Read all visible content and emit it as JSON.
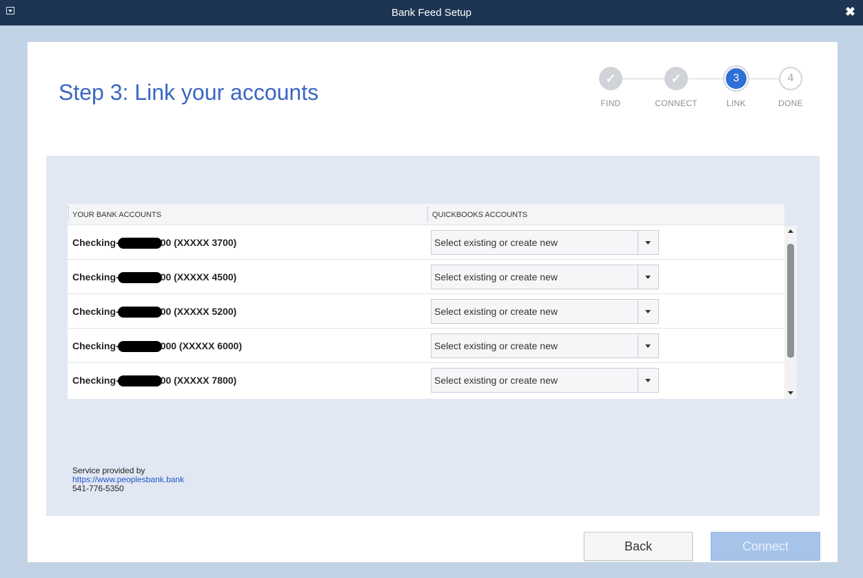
{
  "window": {
    "title": "Bank Feed Setup"
  },
  "page": {
    "heading": "Step 3: Link your accounts"
  },
  "steps": [
    {
      "label": "FIND",
      "state": "done",
      "mark": "✓"
    },
    {
      "label": "CONNECT",
      "state": "done",
      "mark": "✓"
    },
    {
      "label": "LINK",
      "state": "active",
      "mark": "3"
    },
    {
      "label": "DONE",
      "state": "todo",
      "mark": "4"
    }
  ],
  "table": {
    "col_bank": "YOUR BANK ACCOUNTS",
    "col_qb": "QUICKBOOKS ACCOUNTS",
    "rows": [
      {
        "prefix": "Checking-",
        "suffix": "00 (XXXXX 3700)",
        "select": "Select existing or create new"
      },
      {
        "prefix": "Checking-",
        "suffix": "00 (XXXXX 4500)",
        "select": "Select existing or create new"
      },
      {
        "prefix": "Checking-",
        "suffix": "00 (XXXXX 5200)",
        "select": "Select existing or create new"
      },
      {
        "prefix": "Checking-",
        "suffix": "000 (XXXXX 6000)",
        "select": "Select existing or create new"
      },
      {
        "prefix": "Checking-",
        "suffix": "00 (XXXXX 7800)",
        "select": "Select existing or create new"
      }
    ]
  },
  "service": {
    "label": "Service provided by",
    "url": "https://www.peoplesbank.bank",
    "phone": "541-776-5350"
  },
  "buttons": {
    "back": "Back",
    "connect": "Connect"
  },
  "colors": {
    "accent": "#2f6fd6",
    "heading": "#3a66c4",
    "titlebar": "#1d3552"
  }
}
